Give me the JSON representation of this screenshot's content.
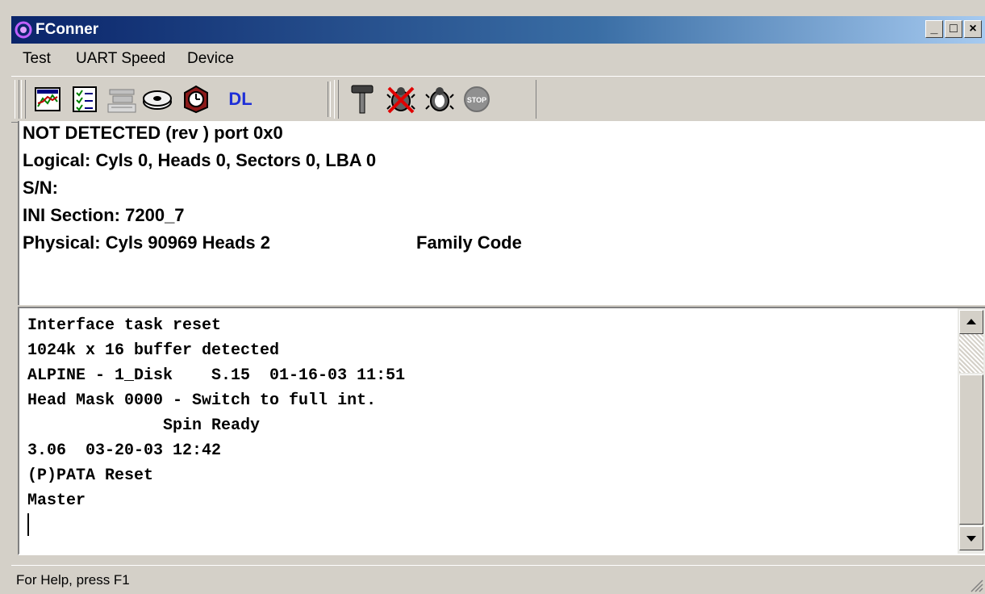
{
  "window": {
    "title": "FConner",
    "minimize": "_",
    "maximize": "□",
    "close": "×"
  },
  "menu": [
    "Test",
    "UART Speed",
    "Device"
  ],
  "toolbar": {
    "buttons": [
      {
        "icon": "chart-icon"
      },
      {
        "icon": "checklist-icon"
      },
      {
        "icon": "device-disabled-icon"
      },
      {
        "icon": "disk-drive-icon"
      },
      {
        "icon": "stopwatch-icon"
      },
      {
        "icon": "dl-icon",
        "label": "DL"
      },
      {
        "icon": "hammer-icon"
      },
      {
        "icon": "bug-crossed-icon"
      },
      {
        "icon": "bug-icon"
      },
      {
        "icon": "stop-disabled-icon",
        "label": "STOP"
      }
    ],
    "dl_label": "DL",
    "stop_label": "STOP"
  },
  "info": {
    "line1": "NOT DETECTED (rev ) port 0x0",
    "line2": "Logical: Cyls 0, Heads 0, Sectors 0, LBA 0",
    "line3": "S/N:",
    "line4": "INI Section: 7200_7",
    "line5a": "Physical: Cyls 90969 Heads 2",
    "line5b": "Family Code"
  },
  "console": {
    "lines": [
      "Interface task reset",
      "1024k x 16 buffer detected",
      "ALPINE - 1_Disk    S.15  01-16-03 11:51",
      "Head Mask 0000 - Switch to full int.",
      "              Spin Ready",
      "3.06  03-20-03 12:42",
      "(P)PATA Reset",
      "Master"
    ]
  },
  "status": {
    "text": "For Help, press F1"
  }
}
